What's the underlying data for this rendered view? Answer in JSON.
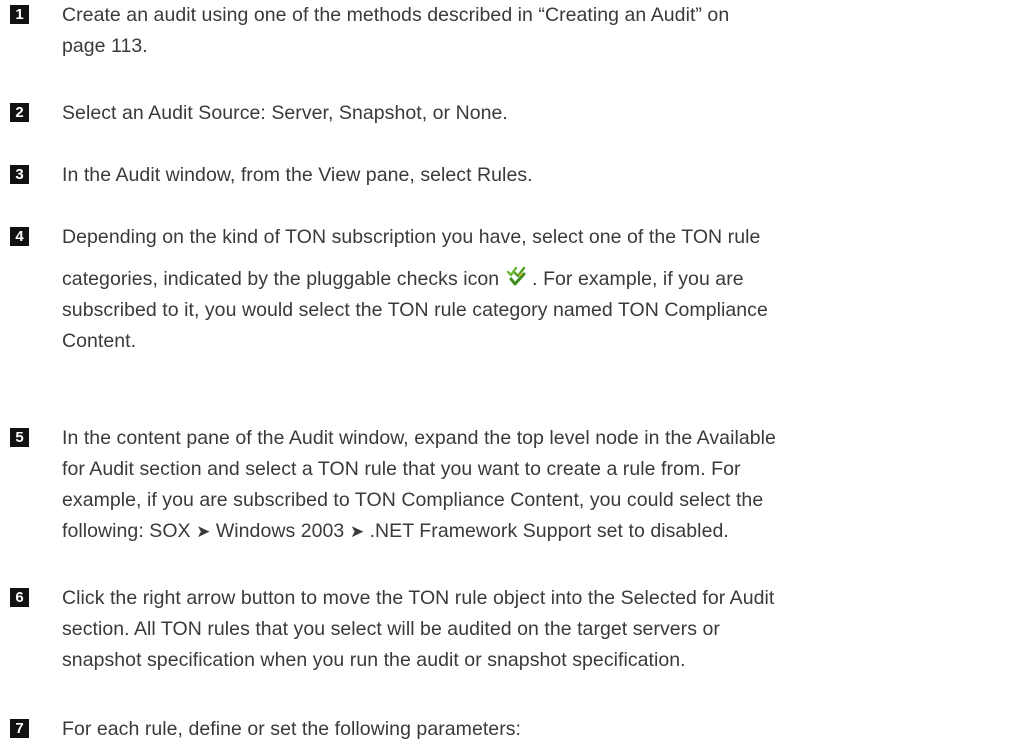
{
  "steps": [
    {
      "number": "1",
      "lines": [
        "Create an audit using one of the methods described in “Creating an Audit” on",
        "page 113."
      ]
    },
    {
      "number": "2",
      "lines": [
        "Select an Audit Source: Server, Snapshot, or None."
      ]
    },
    {
      "number": "3",
      "lines": [
        "In the Audit window, from the View pane, select Rules."
      ]
    },
    {
      "number": "4",
      "line1": "Depending on the kind of TON subscription you have, select one of the TON rule",
      "line2_before_icon": "categories, indicated by the pluggable checks icon",
      "icon": "pluggable-checks-icon",
      "line2_after_icon": ". For example, if you are",
      "line3": "subscribed to it, you would select the TON rule category named TON Compliance",
      "line4": "Content."
    },
    {
      "number": "5",
      "line1": "In the content pane of the Audit window, expand the top level node in the Available",
      "line2": "for Audit section and select a TON rule that you want to create a rule from. For",
      "line3": "example, if you are subscribed to TON Compliance Content, you could select the",
      "line4_a": "following: SOX",
      "arrow": "➤",
      "line4_b": "Windows 2003",
      "line4_c": ".NET Framework Support set to disabled."
    },
    {
      "number": "6",
      "lines": [
        "Click the right arrow button to move the TON rule object into the Selected for Audit",
        "section. All TON rules that you select will be audited on the target servers or",
        "snapshot specification when you run the audit or snapshot specification."
      ]
    },
    {
      "number": "7",
      "lines": [
        "For each rule, define or set the following parameters:"
      ]
    }
  ]
}
